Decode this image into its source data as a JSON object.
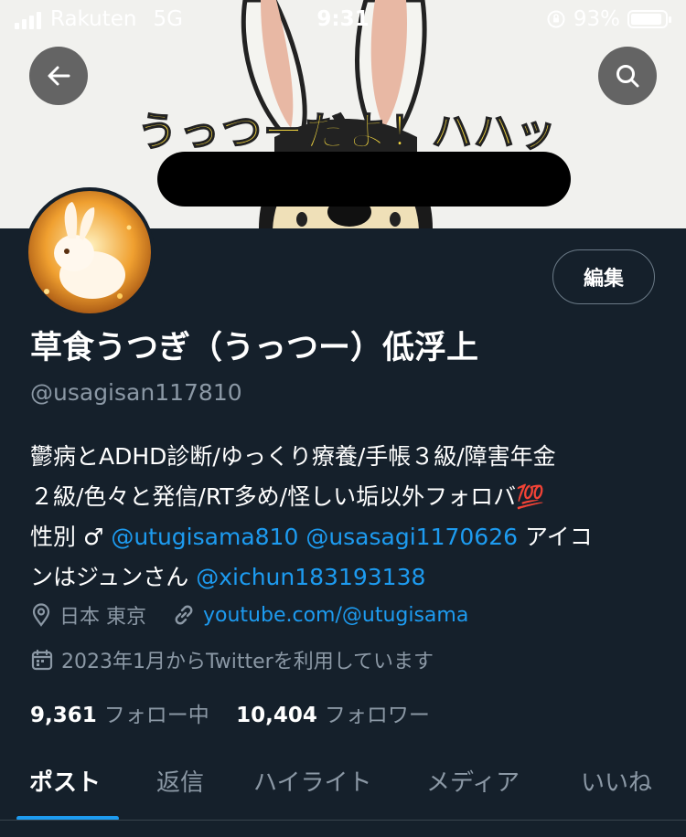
{
  "status_bar": {
    "carrier": "Rakuten",
    "network": "5G",
    "time": "9:31",
    "battery_percent": "93%",
    "battery_level": 0.93
  },
  "header": {
    "back_icon": "arrow-left-icon",
    "search_icon": "search-icon",
    "banner_caption": "うっつーだよ！ハハッ"
  },
  "profile": {
    "edit_label": "編集",
    "display_name": "草食うつぎ（うっつー）低浮上",
    "handle": "@usagisan117810",
    "bio_line1": "鬱病とADHD診断/ゆっくり療養/手帳３級/障害年金",
    "bio_line2": "２級/色々と発信/RT多め/怪しい垢以外フォロバ💯",
    "bio_line3_prefix": "性別 ♂ ",
    "mention1": "@utugisama810",
    "mention2": "@usasagi1170626",
    "bio_line3_suffix": " アイコ",
    "bio_line4_prefix": "ンはジュンさん ",
    "mention3": "@xichun183193138",
    "location": "日本 東京",
    "website": "youtube.com/@utugisama",
    "joined": "2023年1月からTwitterを利用しています",
    "following_count": "9,361",
    "following_label": "フォロー中",
    "followers_count": "10,404",
    "followers_label": "フォロワー"
  },
  "tabs": [
    {
      "label": "ポスト",
      "active": true
    },
    {
      "label": "返信",
      "active": false
    },
    {
      "label": "ハイライト",
      "active": false
    },
    {
      "label": "メディア",
      "active": false
    },
    {
      "label": "いいね",
      "active": false
    }
  ],
  "colors": {
    "background": "#15202b",
    "accent": "#1d9bf0",
    "secondary_text": "#8b98a5"
  }
}
